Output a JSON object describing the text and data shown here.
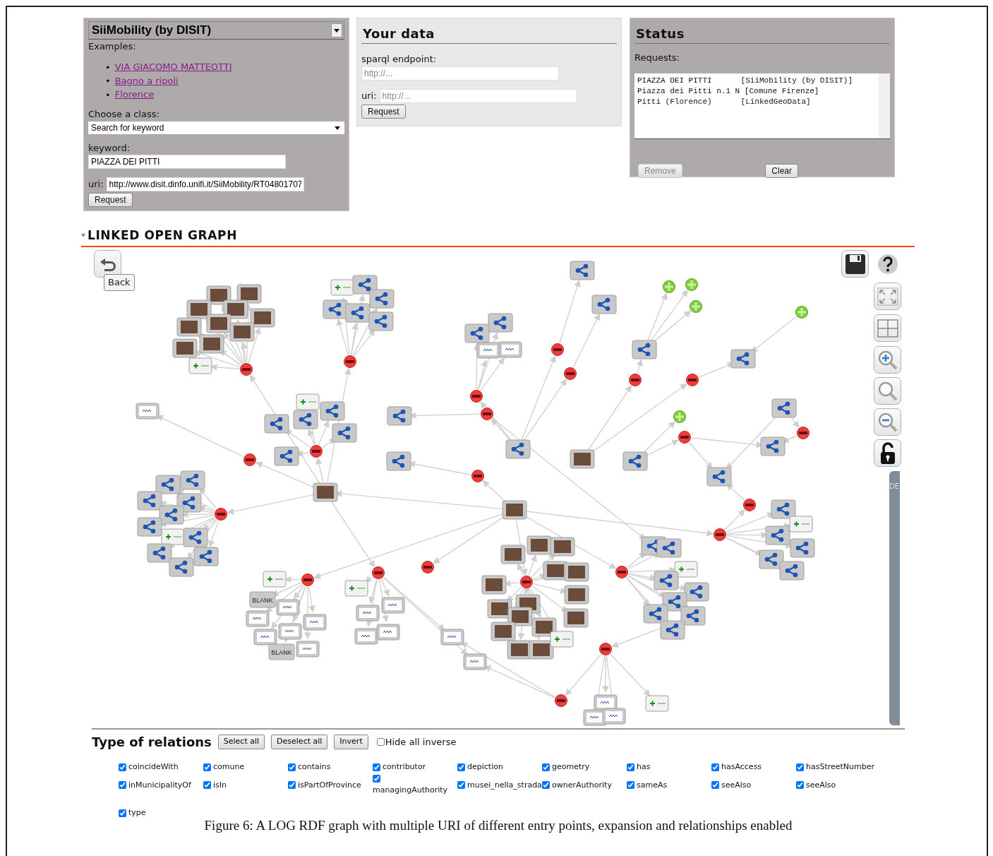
{
  "source_panel": {
    "source": "SiiMobility (by DISIT)",
    "examples_label": "Examples:",
    "examples": [
      {
        "marker": "•",
        "text": "VIA GIACOMO MATTEOTTI"
      },
      {
        "marker": "•",
        "text": "Bagno a ripoli"
      },
      {
        "marker": "•",
        "text": "Florence"
      }
    ],
    "class_label": "Choose a class:",
    "class_value": "Search for keyword",
    "keyword_label": "keyword:",
    "keyword_value": "PIAZZA DEI PITTI",
    "uri_label": "uri:",
    "uri_value": "http://www.disit.dinfo.unifi.it/SiiMobility/RT04801707",
    "button": "Request"
  },
  "your_data": {
    "title": "Your data",
    "endpoint_label": "sparql endpoint:",
    "endpoint_placeholder": "http://...",
    "uri_label": "uri:",
    "uri_placeholder": "http://...",
    "button": "Request"
  },
  "status": {
    "title": "Status",
    "requests_label": "Requests:",
    "requests": [
      {
        "name": "PIAZZA DEI PITTI",
        "source": "[SiiMobility (by DISIT)]"
      },
      {
        "name": "Piazza dei Pitti n.1 N",
        "source": "[Comune Firenze]"
      },
      {
        "name": "Pitti (Florence)",
        "source": "[LinkedGeoData]"
      }
    ],
    "buttons": [
      {
        "label": "Remove",
        "disabled": true
      },
      {
        "label": "Clear",
        "disabled": false
      }
    ]
  },
  "graph": {
    "title": "LINKED OPEN GRAPH",
    "back_label": "Back",
    "side_tab": "DE",
    "nodes": [
      {
        "kind": "resource"
      },
      {
        "kind": "resource"
      },
      {
        "kind": "predicate",
        "expanded": true
      },
      {
        "kind": "predicate",
        "expanded": true
      },
      {
        "kind": "resource"
      },
      {
        "kind": "predicate",
        "expanded": false
      },
      {
        "kind": "predicate",
        "expanded": false
      },
      {
        "kind": "predicate",
        "expanded": false
      },
      {
        "kind": "resource"
      },
      {
        "kind": "predicate",
        "expanded": true
      },
      {
        "kind": "photo"
      },
      {
        "kind": "predicate",
        "expanded": true
      },
      {
        "kind": "resource"
      },
      {
        "kind": "predicate",
        "expanded": false
      },
      {
        "kind": "predicate",
        "expanded": false
      },
      {
        "kind": "predicate",
        "expanded": true
      },
      {
        "kind": "resource"
      },
      {
        "kind": "resource"
      },
      {
        "kind": "predicate",
        "expanded": true
      },
      {
        "kind": "resource"
      },
      {
        "kind": "resource"
      },
      {
        "kind": "predicate",
        "expanded": true
      },
      {
        "kind": "predicate",
        "expanded": true
      },
      {
        "kind": "resource"
      },
      {
        "kind": "resource"
      },
      {
        "kind": "literal"
      },
      {
        "kind": "literal"
      },
      {
        "kind": "resource"
      },
      {
        "kind": "predicate",
        "expanded": true
      },
      {
        "kind": "resource"
      },
      {
        "kind": "photo"
      },
      {
        "kind": "photo"
      },
      {
        "kind": "literal"
      },
      {
        "kind": "predicate",
        "expanded": true
      },
      {
        "kind": "predicate",
        "expanded": true
      },
      {
        "kind": "resource"
      },
      {
        "kind": "resource"
      },
      {
        "kind": "resource"
      },
      {
        "kind": "resource"
      },
      {
        "kind": "resource"
      },
      {
        "kind": "add"
      },
      {
        "kind": "predicate",
        "expanded": true
      },
      {
        "kind": "add"
      },
      {
        "kind": "resource"
      },
      {
        "kind": "resource"
      },
      {
        "kind": "resource"
      },
      {
        "kind": "resource"
      },
      {
        "kind": "resource"
      },
      {
        "kind": "predicate",
        "expanded": true
      },
      {
        "kind": "add"
      },
      {
        "kind": "photo"
      },
      {
        "kind": "photo"
      },
      {
        "kind": "photo"
      },
      {
        "kind": "photo"
      },
      {
        "kind": "photo"
      },
      {
        "kind": "photo"
      },
      {
        "kind": "photo"
      },
      {
        "kind": "photo"
      },
      {
        "kind": "photo"
      },
      {
        "kind": "photo"
      },
      {
        "kind": "predicate",
        "expanded": true
      },
      {
        "kind": "resource"
      },
      {
        "kind": "resource"
      },
      {
        "kind": "resource"
      },
      {
        "kind": "resource"
      },
      {
        "kind": "resource"
      },
      {
        "kind": "resource"
      },
      {
        "kind": "add"
      },
      {
        "kind": "resource"
      },
      {
        "kind": "resource"
      },
      {
        "kind": "resource"
      },
      {
        "kind": "resource"
      },
      {
        "kind": "predicate",
        "expanded": true
      },
      {
        "kind": "add"
      },
      {
        "kind": "blank",
        "text": "BLANK"
      },
      {
        "kind": "literal"
      },
      {
        "kind": "literal"
      },
      {
        "kind": "literal"
      },
      {
        "kind": "literal"
      },
      {
        "kind": "literal"
      },
      {
        "kind": "blank",
        "text": "BLANK"
      },
      {
        "kind": "literal"
      },
      {
        "kind": "predicate",
        "expanded": true
      },
      {
        "kind": "add"
      },
      {
        "kind": "literal"
      },
      {
        "kind": "literal"
      },
      {
        "kind": "literal"
      },
      {
        "kind": "literal"
      },
      {
        "kind": "literal"
      },
      {
        "kind": "literal"
      },
      {
        "kind": "predicate",
        "expanded": true
      },
      {
        "kind": "predicate",
        "expanded": true
      },
      {
        "kind": "photo"
      },
      {
        "kind": "photo"
      },
      {
        "kind": "photo"
      },
      {
        "kind": "photo"
      },
      {
        "kind": "photo"
      },
      {
        "kind": "photo"
      },
      {
        "kind": "photo"
      },
      {
        "kind": "photo"
      },
      {
        "kind": "photo"
      },
      {
        "kind": "photo"
      },
      {
        "kind": "photo"
      },
      {
        "kind": "photo"
      },
      {
        "kind": "photo"
      },
      {
        "kind": "photo"
      },
      {
        "kind": "photo"
      },
      {
        "kind": "add"
      },
      {
        "kind": "predicate",
        "expanded": true
      },
      {
        "kind": "add"
      },
      {
        "kind": "resource"
      },
      {
        "kind": "resource"
      },
      {
        "kind": "resource"
      },
      {
        "kind": "resource"
      },
      {
        "kind": "resource"
      },
      {
        "kind": "resource"
      },
      {
        "kind": "resource"
      },
      {
        "kind": "resource"
      },
      {
        "kind": "predicate",
        "expanded": true
      },
      {
        "kind": "predicate",
        "expanded": true
      },
      {
        "kind": "resource"
      },
      {
        "kind": "resource"
      },
      {
        "kind": "add"
      },
      {
        "kind": "resource"
      },
      {
        "kind": "resource"
      },
      {
        "kind": "resource"
      },
      {
        "kind": "predicate",
        "expanded": true
      },
      {
        "kind": "predicate",
        "expanded": true
      },
      {
        "kind": "literal"
      },
      {
        "kind": "literal"
      },
      {
        "kind": "literal"
      },
      {
        "kind": "add"
      }
    ]
  },
  "relations": {
    "title": "Type of relations",
    "buttons": [
      "Select all",
      "Deselect all",
      "Invert"
    ],
    "hide_inverse": {
      "label": "Hide all inverse",
      "checked": false
    },
    "items": [
      {
        "label": "coincideWith",
        "checked": true
      },
      {
        "label": "comune",
        "checked": true
      },
      {
        "label": "contains",
        "checked": true
      },
      {
        "label": "contributor",
        "checked": true
      },
      {
        "label": "depiction",
        "checked": true
      },
      {
        "label": "geometry",
        "checked": true
      },
      {
        "label": "has",
        "checked": true
      },
      {
        "label": "hasAccess",
        "checked": true
      },
      {
        "label": "hasStreetNumber",
        "checked": true
      },
      {
        "label": "inMunicipalityOf",
        "checked": true
      },
      {
        "label": "isIn",
        "checked": true
      },
      {
        "label": "isPartOfProvince",
        "checked": true
      },
      {
        "label": "managingAuthority",
        "checked": true
      },
      {
        "label": "musei_nella_strada",
        "checked": true
      },
      {
        "label": "ownerAuthority",
        "checked": true
      },
      {
        "label": "sameAs",
        "checked": true
      },
      {
        "label": "seeAlso",
        "checked": true
      },
      {
        "label": "seeAlso",
        "checked": true
      },
      {
        "label": "type",
        "checked": true
      }
    ]
  },
  "caption": "Figure 6: A LOG RDF graph with multiple URI of different entry points, expansion and relationships enabled"
}
